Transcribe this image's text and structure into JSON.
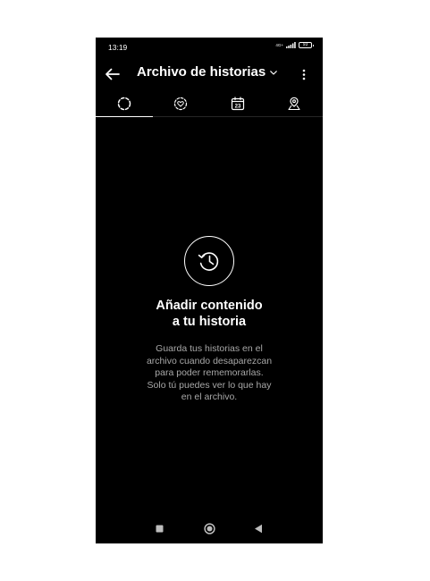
{
  "status_bar": {
    "time": "13:19",
    "network": "4G+",
    "battery": "93"
  },
  "header": {
    "title": "Archivo de historias",
    "back_icon": "arrow-left-icon",
    "dropdown_icon": "chevron-down-icon",
    "more_icon": "more-vertical-icon"
  },
  "tabs": [
    {
      "icon": "stories-archive-icon",
      "active": true
    },
    {
      "icon": "highlights-heart-icon",
      "active": false
    },
    {
      "icon": "calendar-icon",
      "calendar_day": "23",
      "active": false
    },
    {
      "icon": "map-pin-icon",
      "active": false
    }
  ],
  "empty_state": {
    "icon": "history-clock-icon",
    "heading_lines": [
      "Añadir contenido",
      "a tu historia"
    ],
    "body_lines": [
      "Guarda tus historias en el",
      "archivo cuando desaparezcan",
      "para poder rememorarlas.",
      "Solo tú puedes ver lo que hay",
      "en el archivo."
    ]
  },
  "nav_bar": {
    "recents_icon": "square-icon",
    "home_icon": "circle-home-icon",
    "back_icon": "triangle-back-icon"
  },
  "colors": {
    "background": "#000000",
    "text": "#ffffff",
    "secondary_text": "#a8a8a8",
    "divider": "#262626"
  }
}
